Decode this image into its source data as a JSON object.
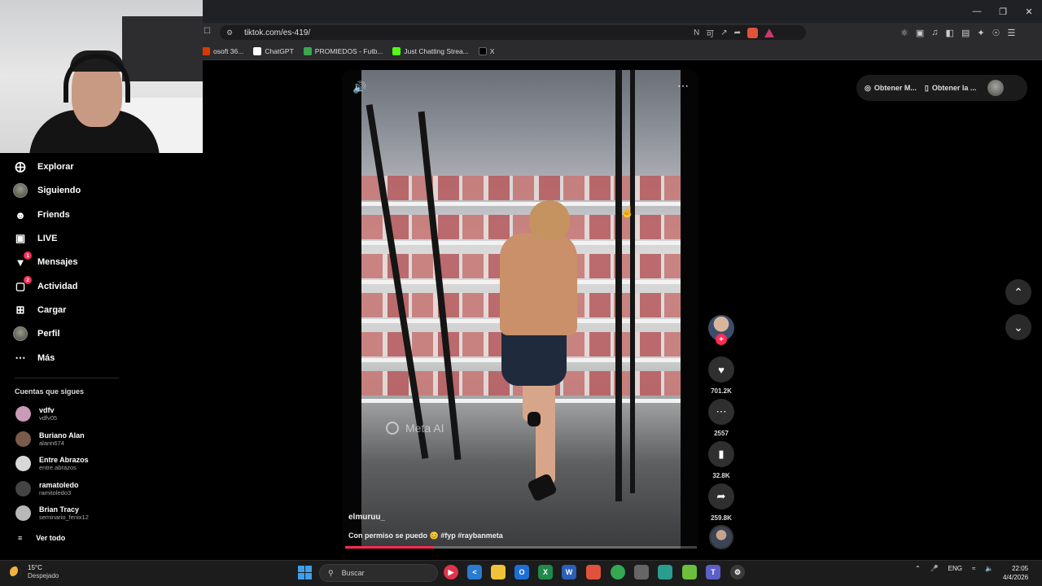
{
  "browser": {
    "url": "tiktok.com/es-419/",
    "bookmarks": [
      {
        "label": "osoft 36...",
        "color": "#d83b01"
      },
      {
        "label": "ChatGPT",
        "color": "#ffffff"
      },
      {
        "label": "PROMIEDOS - Futb...",
        "color": "#3aa84b"
      },
      {
        "label": "Just Chatting Strea...",
        "color": "#53fc18"
      },
      {
        "label": "X",
        "color": "#000000"
      }
    ]
  },
  "sidebar": {
    "items": [
      {
        "label": "Explorar",
        "icon": "compass-icon"
      },
      {
        "label": "Siguiendo",
        "icon": "avatar"
      },
      {
        "label": "Friends",
        "icon": "friends-icon"
      },
      {
        "label": "LIVE",
        "icon": "live-icon"
      },
      {
        "label": "Mensajes",
        "icon": "inbox-icon",
        "badge": "1"
      },
      {
        "label": "Actividad",
        "icon": "activity-icon",
        "badge": "2"
      },
      {
        "label": "Cargar",
        "icon": "upload-icon"
      },
      {
        "label": "Perfil",
        "icon": "avatar"
      },
      {
        "label": "Más",
        "icon": "more-icon"
      }
    ],
    "following_title": "Cuentas que sigues",
    "following": [
      {
        "name": "vdfv",
        "username": "vdfv05",
        "color": "#c99bb8"
      },
      {
        "name": "Buriano Alan",
        "username": "alann674",
        "color": "#7a5a4a"
      },
      {
        "name": "Entre Abrazos",
        "username": "entre.abrazos",
        "color": "#d8d8d8"
      },
      {
        "name": "ramatoledo",
        "username": "ramitoledo3",
        "color": "#444444"
      },
      {
        "name": "Brian Tracy",
        "username": "seminario_fenix12",
        "color": "#b8b8b8"
      }
    ],
    "see_all": "Ver todo"
  },
  "video": {
    "watermark": "Meta AI",
    "author": "elmuruu_",
    "caption": "Con permiso se puedo 😊 #fyp #raybanmeta",
    "progress": 0.25
  },
  "actions": {
    "likes": "701.2K",
    "comments": "2557",
    "saves": "32.8K",
    "shares": "259.8K"
  },
  "topbar": {
    "get_coins": "Obtener M...",
    "get_app": "Obtener la ..."
  },
  "taskbar": {
    "temp": "15°C",
    "weather": "Despejado",
    "search_placeholder": "Buscar",
    "lang": "ENG",
    "time": "22:05",
    "date": "4/4/2026"
  }
}
